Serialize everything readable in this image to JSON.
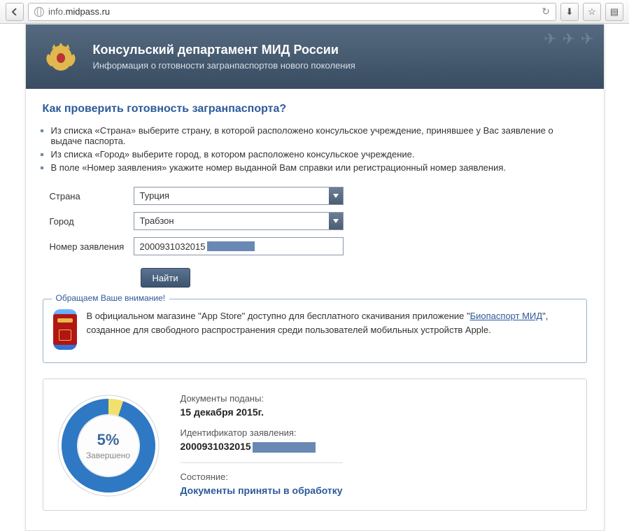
{
  "browser": {
    "url_prefix": "info.",
    "url_host": "midpass.ru"
  },
  "header": {
    "title": "Консульский департамент МИД России",
    "subtitle": "Информация о готовности загранпаспортов нового поколения"
  },
  "page_title": "Как проверить готовность загранпаспорта?",
  "instructions": [
    "Из списка «Страна» выберите страну, в которой расположено консульское учреждение, принявшее у Вас заявление о выдаче паспорта.",
    "Из списка «Город» выберите город, в котором расположено консульское учреждение.",
    "В поле «Номер заявления» укажите номер выданной Вам справки или регистрационный номер заявления."
  ],
  "form": {
    "country_label": "Страна",
    "country_value": "Турция",
    "city_label": "Город",
    "city_value": "Трабзон",
    "appnum_label": "Номер заявления",
    "appnum_value_visible": "2000931032015",
    "find_button": "Найти"
  },
  "notice": {
    "legend": "Обращаем Ваше внимание!",
    "text_before": "В официальном магазине \"App Store\" доступно для бесплатного скачивания приложение \"",
    "link_text": "Биопаспорт МИД",
    "text_after": "\", созданное для свободного распространения среди пользователей мобильных устройств Apple."
  },
  "result": {
    "percent": "5%",
    "percent_label": "Завершено",
    "docs_submitted_key": "Документы поданы:",
    "docs_submitted_val": "15 декабря 2015г.",
    "id_key": "Идентификатор заявления:",
    "id_val_visible": "2000931032015",
    "status_key": "Состояние:",
    "status_val": "Документы приняты в обработку"
  }
}
